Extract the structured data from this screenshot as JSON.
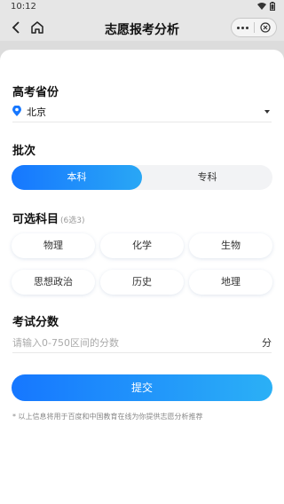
{
  "status_bar": {
    "time": "10:12"
  },
  "nav": {
    "title": "志愿报考分析"
  },
  "province": {
    "label": "高考省份",
    "value": "北京"
  },
  "batch": {
    "label": "批次",
    "options": [
      "本科",
      "专科"
    ],
    "selected": "本科"
  },
  "subjects": {
    "label": "可选科目",
    "hint": "(6选3)",
    "items": [
      "物理",
      "化学",
      "生物",
      "思想政治",
      "历史",
      "地理"
    ]
  },
  "score": {
    "label": "考试分数",
    "placeholder": "请输入0-750区间的分数",
    "unit": "分"
  },
  "submit": {
    "label": "提交"
  },
  "disclaimer": "* 以上信息将用于百度和中国教育在线为你提供志愿分析推荐",
  "colors": {
    "accent_start": "#1677ff",
    "accent_end": "#2bb0f6",
    "pin": "#1677ff"
  }
}
